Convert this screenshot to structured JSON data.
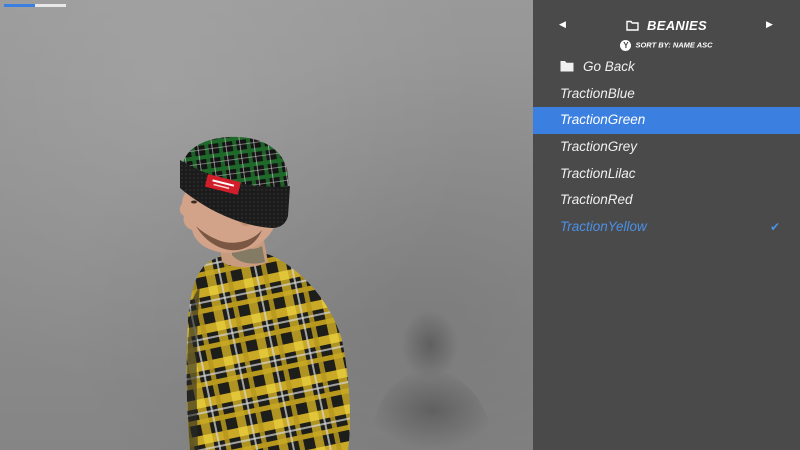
{
  "loading_progress": 0.5,
  "menu": {
    "category_title": "BEANIES",
    "category_icon": "folder-icon",
    "prev_icon": "triangle-left-icon",
    "next_icon": "triangle-right-icon",
    "sort_button_badge": "Y",
    "sort_label": "SORT BY: NAME ASC",
    "back_item": {
      "label": "Go Back",
      "icon": "folder-icon"
    },
    "items": [
      {
        "label": "TractionBlue",
        "state": "normal"
      },
      {
        "label": "TractionGreen",
        "state": "selected"
      },
      {
        "label": "TractionGrey",
        "state": "normal"
      },
      {
        "label": "TractionLilac",
        "state": "normal"
      },
      {
        "label": "TractionRed",
        "state": "normal"
      },
      {
        "label": "TractionYellow",
        "state": "equipped"
      }
    ],
    "equipped_check": "✔",
    "colors": {
      "panel_bg": "#4a4a4a",
      "highlight": "#3b7fe0",
      "equipped_text": "#4a90e8"
    }
  }
}
